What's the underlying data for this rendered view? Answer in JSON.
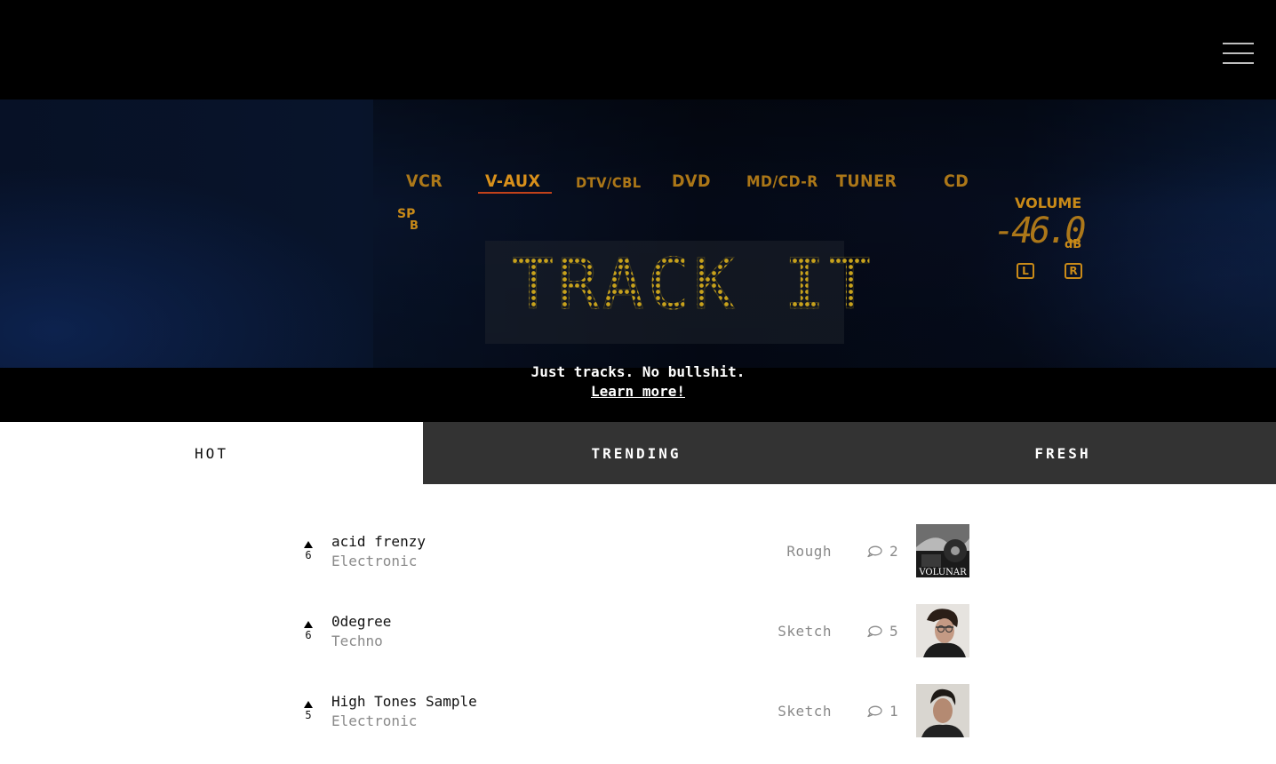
{
  "hero": {
    "logo_text": "TRACK IT",
    "sources": [
      "VCR",
      "V-AUX",
      "DTV/CBL",
      "DVD",
      "MD/CD-R",
      "TUNER",
      "CD"
    ],
    "active_source": "V-AUX",
    "sp_label": "SP",
    "sp_sub": "B",
    "volume_label": "VOLUME",
    "volume_value": "-46.0",
    "volume_unit": "dB",
    "left_indicator": "L",
    "right_indicator": "R",
    "tagline": "Just tracks. No bullshit.",
    "learn_more": "Learn more!",
    "accent_color": "#c98a18"
  },
  "menu": {
    "icon": "hamburger-menu-icon"
  },
  "tabs": [
    {
      "label": "HOT",
      "active": true
    },
    {
      "label": "TRENDING",
      "active": false
    },
    {
      "label": "FRESH",
      "active": false
    }
  ],
  "tracks": [
    {
      "votes": "6",
      "title": "acid frenzy",
      "genre": "Electronic",
      "status": "Rough",
      "comments": "2",
      "thumb_label": "VOLUNAR"
    },
    {
      "votes": "6",
      "title": "0degree",
      "genre": "Techno",
      "status": "Sketch",
      "comments": "5"
    },
    {
      "votes": "5",
      "title": "High Tones Sample",
      "genre": "Electronic",
      "status": "Sketch",
      "comments": "1"
    }
  ]
}
